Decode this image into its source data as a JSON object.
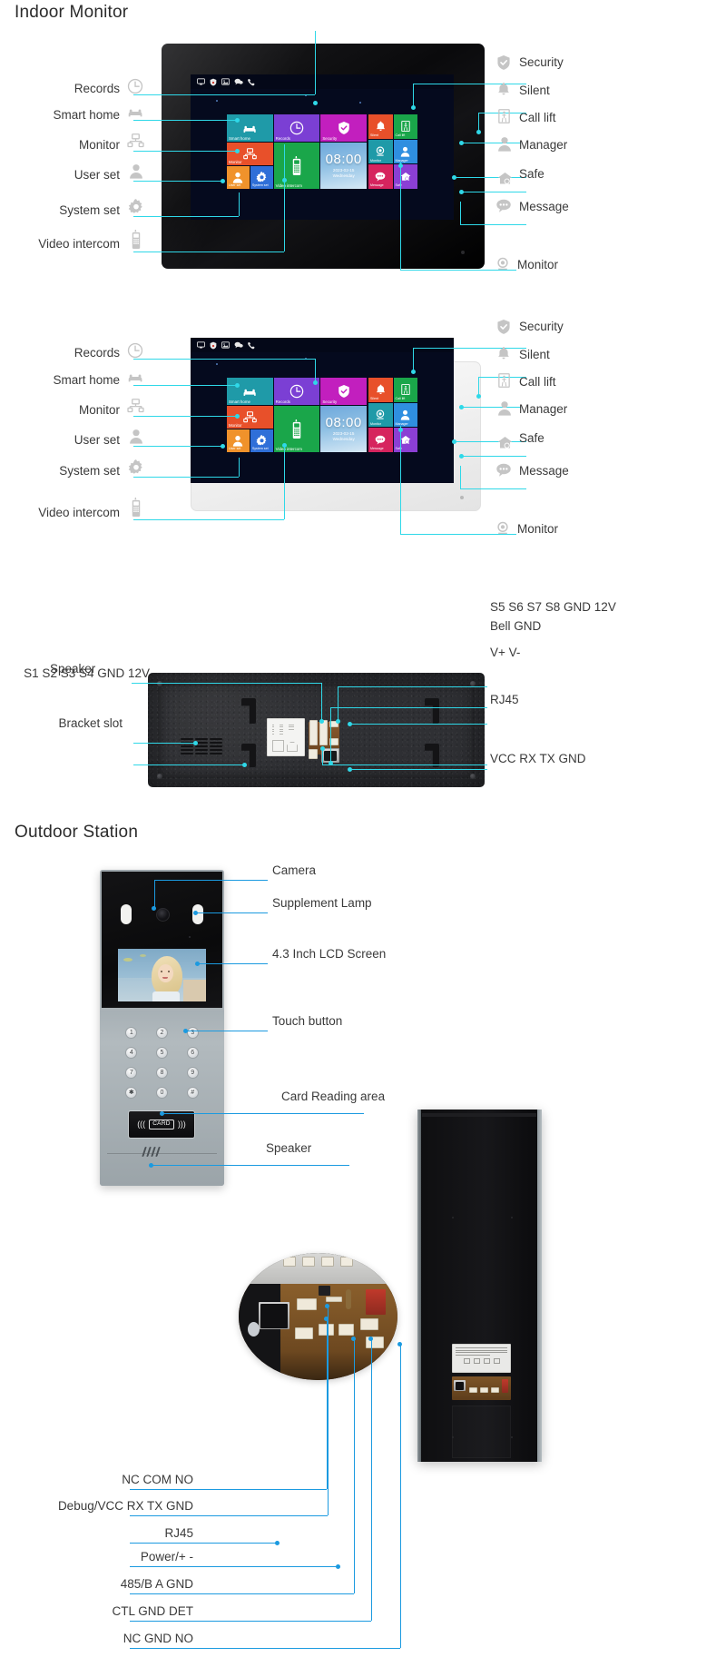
{
  "sections": {
    "indoor_title": "Indoor Monitor",
    "outdoor_title": "Outdoor Station"
  },
  "indoor_monitor": {
    "left_labels": [
      {
        "text": "Records",
        "icon": "clock-icon"
      },
      {
        "text": "Smart home",
        "icon": "sofa-icon"
      },
      {
        "text": "Monitor",
        "icon": "network-icon"
      },
      {
        "text": "User set",
        "icon": "person-icon"
      },
      {
        "text": "System set",
        "icon": "gear-icon"
      },
      {
        "text": "Video intercom",
        "icon": "handset-icon"
      }
    ],
    "right_labels": [
      {
        "text": "Security",
        "icon": "shield-check-icon"
      },
      {
        "text": "Silent",
        "icon": "bell-icon"
      },
      {
        "text": "Call lift",
        "icon": "elevator-icon"
      },
      {
        "text": "Manager",
        "icon": "person-icon"
      },
      {
        "text": "Safe",
        "icon": "house-shield-icon"
      },
      {
        "text": "Message",
        "icon": "chat-icon"
      },
      {
        "text": "Monitor",
        "icon": "camera-icon"
      }
    ],
    "screen": {
      "statusbar_icons": [
        "monitor-icon",
        "shield-icon",
        "picture-icon",
        "chat-icon",
        "phone-icon"
      ],
      "tiles": [
        {
          "label": "Smart home",
          "color": "#1f9aa8",
          "icon": "sofa-icon"
        },
        {
          "label": "Records",
          "color": "#7b3fd4",
          "icon": "clock-icon"
        },
        {
          "label": "Security",
          "color": "#c21fbe",
          "icon": "shield-check-icon"
        },
        {
          "label": "Silent",
          "color": "#e8502a",
          "icon": "bell-icon"
        },
        {
          "label": "Call lift",
          "color": "#1aa64a",
          "icon": "elevator-icon"
        },
        {
          "label": "Monitor",
          "color": "#e8502a",
          "icon": "network-icon"
        },
        {
          "label": "Video intercom",
          "color": "#1aa64a",
          "icon": "handset-icon"
        },
        {
          "label": "Monitor",
          "color": "#1f9aa8",
          "icon": "camera-icon"
        },
        {
          "label": "Manager",
          "color": "#2f8fe0",
          "icon": "person-icon"
        },
        {
          "label": "User set",
          "color": "#f0922b",
          "icon": "person-icon"
        },
        {
          "label": "System set",
          "color": "#2f6fd8",
          "icon": "gear-icon"
        },
        {
          "label": "Message",
          "color": "#d6245e",
          "icon": "chat-icon"
        },
        {
          "label": "Safe",
          "color": "#8b3fd4",
          "icon": "house-shield-icon"
        }
      ],
      "clock": {
        "time": "08:00",
        "date": "2023-02-15",
        "day": "Wednesday"
      }
    }
  },
  "rear_panel": {
    "left_labels": [
      {
        "text": "S1 S2 S3 S4 GND 12V"
      },
      {
        "text": "Speaker"
      },
      {
        "text": "Bracket slot"
      }
    ],
    "right_labels": [
      {
        "text": "S5 S6 S7 S8 GND 12V"
      },
      {
        "text": "Bell GND"
      },
      {
        "text": "V+ V-"
      },
      {
        "text": "RJ45"
      },
      {
        "text": "VCC RX TX GND"
      }
    ]
  },
  "outdoor_station": {
    "right_labels": [
      {
        "text": "Camera"
      },
      {
        "text": "Supplement Lamp"
      },
      {
        "text": "4.3 Inch LCD Screen"
      },
      {
        "text": "Touch button"
      },
      {
        "text": "Card Reading area"
      },
      {
        "text": "Speaker"
      }
    ],
    "keypad": [
      "1",
      "2",
      "3",
      "4",
      "5",
      "6",
      "7",
      "8",
      "9",
      "✱",
      "0",
      "#"
    ],
    "card_label": "CARD"
  },
  "pcb_detail": {
    "labels": [
      {
        "text": "NC COM NO"
      },
      {
        "text": "Debug/VCC RX TX GND"
      },
      {
        "text": "RJ45"
      },
      {
        "text": "Power/+ -"
      },
      {
        "text": "485/B A GND"
      },
      {
        "text": "CTL GND DET"
      },
      {
        "text": "NC GND NO"
      }
    ]
  },
  "colors": {
    "leader_cyan": "#2fd8e8",
    "leader_blue": "#1b9ae0",
    "text": "#3a3a3a"
  }
}
